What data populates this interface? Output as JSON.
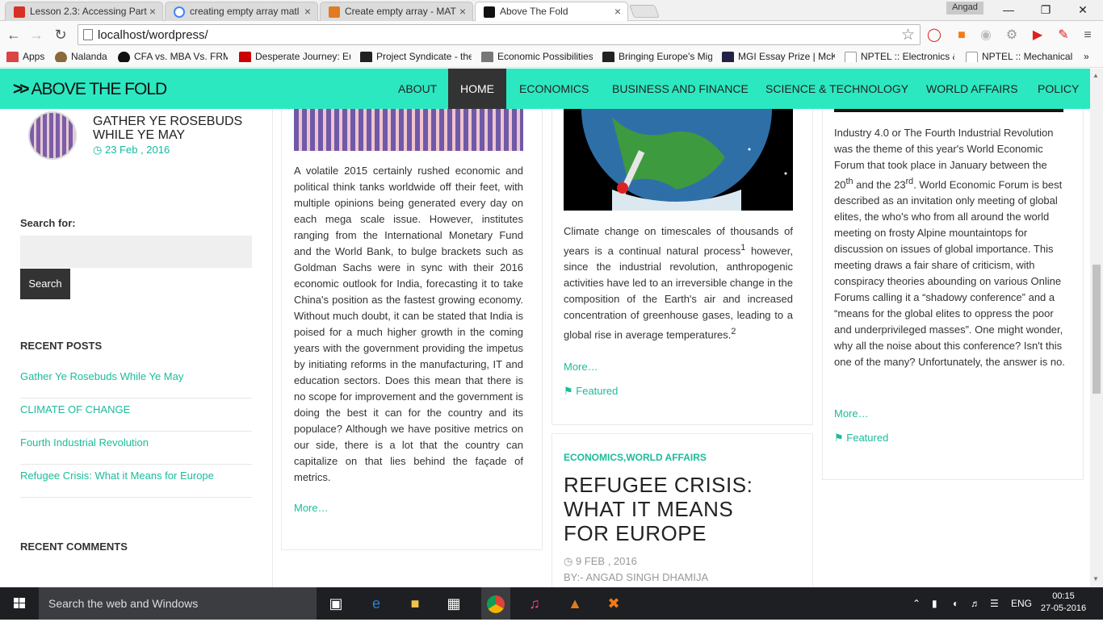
{
  "browser": {
    "tabs": [
      {
        "title": "Lesson 2.3: Accessing Part",
        "color": "#d93025"
      },
      {
        "title": "creating empty array matl",
        "color": "#4285f4"
      },
      {
        "title": "Create empty array - MAT",
        "color": "#e07b21"
      },
      {
        "title": "Above The Fold",
        "color": "#111111"
      }
    ],
    "profile": "Angad",
    "url": "localhost/wordpress/",
    "bookmarks": [
      {
        "label": "Apps",
        "color": "#d44"
      },
      {
        "label": "Nalanda",
        "color": "#8a6a3a"
      },
      {
        "label": "CFA vs. MBA Vs. FRM:",
        "color": "#111"
      },
      {
        "label": "Desperate Journey: Eu",
        "color": "#c00"
      },
      {
        "label": "Project Syndicate - the",
        "color": "#222"
      },
      {
        "label": "Economic Possibilities",
        "color": "#777"
      },
      {
        "label": "Bringing Europe's Mig",
        "color": "#222"
      },
      {
        "label": "MGI Essay Prize | McK",
        "color": "#224"
      },
      {
        "label": "NPTEL :: Electronics &",
        "color": "#999"
      },
      {
        "label": "NPTEL :: Mechanical E",
        "color": "#999"
      }
    ]
  },
  "site": {
    "logo": "ABOVE THE FOLD",
    "menu": [
      "ABOUT",
      "HOME",
      "ECONOMICS",
      "BUSINESS AND FINANCE",
      "SCIENCE & TECHNOLOGY",
      "WORLD AFFAIRS",
      "POLICY"
    ],
    "active": "HOME"
  },
  "sidebar": {
    "featured_title": "GATHER YE ROSEBUDS WHILE YE MAY",
    "featured_date": "23 Feb , 2016",
    "search_label": "Search for:",
    "search_button": "Search",
    "recent_posts_heading": "RECENT POSTS",
    "recent_posts": [
      "Gather Ye Rosebuds While Ye May",
      "CLIMATE OF CHANGE",
      "Fourth Industrial Revolution",
      "Refugee Crisis: What it Means for Europe"
    ],
    "recent_comments_heading": "RECENT COMMENTS"
  },
  "posts": {
    "india": {
      "excerpt": "A volatile 2015 certainly rushed economic and political think tanks worldwide off their feet, with multiple opinions being generated every day on each mega scale issue. However, institutes ranging from the International Monetary Fund and the World Bank, to bulge brackets such as Goldman Sachs were in sync with their 2016 economic outlook for India, forecasting it to take China's position as the fastest growing economy. Without much doubt, it can be stated that India is poised for a much higher growth in the coming years with the government providing the impetus by initiating reforms in the manufacturing, IT and education sectors. Does this mean that there is no scope for improvement and the government is doing the best it can for the country and its populace? Although we have positive metrics on our side, there is a lot that the country can capitalize on that lies behind the façade of metrics.",
      "more": "More…"
    },
    "climate": {
      "excerpt_a": "Climate change on timescales of thousands of years is a continual natural process",
      "sup1": "1",
      "excerpt_b": " however, since the industrial revolution, anthropogenic activities have led to an irreversible change in the composition of the Earth's air and increased concentration of greenhouse gases, leading to a global rise in average temperatures.",
      "sup2": "2",
      "more": "More…",
      "tag": "Featured"
    },
    "refugee": {
      "categories": "ECONOMICS,WORLD AFFAIRS",
      "title": "REFUGEE CRISIS: WHAT IT MEANS FOR EUROPE",
      "date": "9 FEB , 2016",
      "author": "BY:- ANGAD SINGH DHAMIJA"
    },
    "industry": {
      "p1": "Industry 4.0 or The Fourth Industrial Revolution was the theme of this year's World Economic Forum that took place in January between the 20",
      "sup_a": "th",
      "p2": " and the 23",
      "sup_b": "rd",
      "p3": ". World Economic Forum is best described as an invitation only meeting of global elites, the who's who from all around the world meeting on frosty Alpine mountaintops for discussion on issues of global importance. This meeting draws a fair share of criticism, with conspiracy theories abounding on various Online Forums calling it a “shadowy conference” and a “means for the global elites to oppress the poor and underprivileged masses”. One might wonder, why all the noise about this conference? Isn't this one of the many? Unfortunately, the answer is no.",
      "more": "More…",
      "tag": "Featured"
    }
  },
  "taskbar": {
    "search_placeholder": "Search the web and Windows",
    "lang": "ENG",
    "time": "00:15",
    "date": "27-05-2016"
  },
  "colors": {
    "accent": "#2ce8c1",
    "link": "#1bbc9b",
    "dark": "#333333"
  }
}
